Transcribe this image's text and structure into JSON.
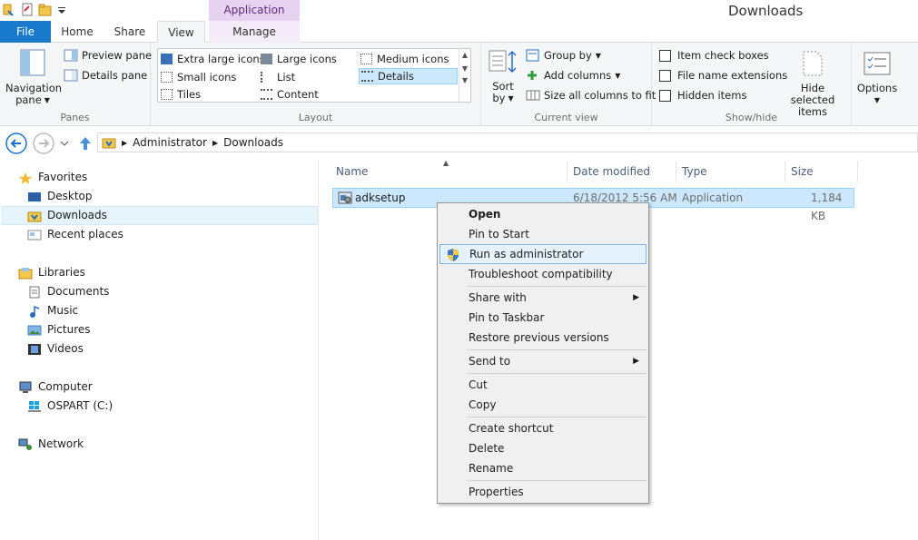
{
  "window": {
    "title": "Downloads",
    "contextual_tab_group": "Application Tools"
  },
  "tabs": {
    "file": "File",
    "home": "Home",
    "share": "Share",
    "view": "View",
    "manage": "Manage"
  },
  "ribbon": {
    "panes": {
      "label": "Panes",
      "navigation_pane_line1": "Navigation",
      "navigation_pane_line2": "pane",
      "preview_pane": "Preview pane",
      "details_pane": "Details pane"
    },
    "layout": {
      "label": "Layout",
      "options": {
        "extra_large_icons": "Extra large icons",
        "large_icons": "Large icons",
        "medium_icons": "Medium icons",
        "small_icons": "Small icons",
        "list": "List",
        "details": "Details",
        "tiles": "Tiles",
        "content": "Content"
      },
      "selected": "Details"
    },
    "current_view": {
      "label": "Current view",
      "sort_by_line1": "Sort",
      "sort_by_line2": "by",
      "group_by": "Group by",
      "add_columns": "Add columns",
      "size_all_columns": "Size all columns to fit"
    },
    "show_hide": {
      "label": "Show/hide",
      "item_check_boxes": "Item check boxes",
      "file_name_extensions": "File name extensions",
      "hidden_items": "Hidden items",
      "hide_selected_line1": "Hide selected",
      "hide_selected_line2": "items"
    },
    "options": {
      "label": "Options"
    }
  },
  "address": {
    "crumbs": [
      "Administrator",
      "Downloads"
    ]
  },
  "nav": {
    "favorites": "Favorites",
    "desktop": "Desktop",
    "downloads": "Downloads",
    "recent_places": "Recent places",
    "libraries": "Libraries",
    "documents": "Documents",
    "music": "Music",
    "pictures": "Pictures",
    "videos": "Videos",
    "computer": "Computer",
    "drive": "OSPART (C:)",
    "network": "Network"
  },
  "columns": {
    "name": "Name",
    "date_modified": "Date modified",
    "type": "Type",
    "size": "Size"
  },
  "files": [
    {
      "name": "adksetup",
      "date_modified": "6/18/2012 5:56 AM",
      "type": "Application",
      "size": "1,184 KB"
    }
  ],
  "context_menu": {
    "open": "Open",
    "pin_to_start": "Pin to Start",
    "run_as_admin": "Run as administrator",
    "troubleshoot": "Troubleshoot compatibility",
    "share_with": "Share with",
    "pin_to_taskbar": "Pin to Taskbar",
    "restore_versions": "Restore previous versions",
    "send_to": "Send to",
    "cut": "Cut",
    "copy": "Copy",
    "create_shortcut": "Create shortcut",
    "delete": "Delete",
    "rename": "Rename",
    "properties": "Properties"
  },
  "colors": {
    "file_tab": "#1979ca",
    "apptools": "#e7d2f1",
    "selection": "#cce8ff",
    "selection_border": "#99d1ff",
    "menu_highlight": "#e5f1fb"
  }
}
